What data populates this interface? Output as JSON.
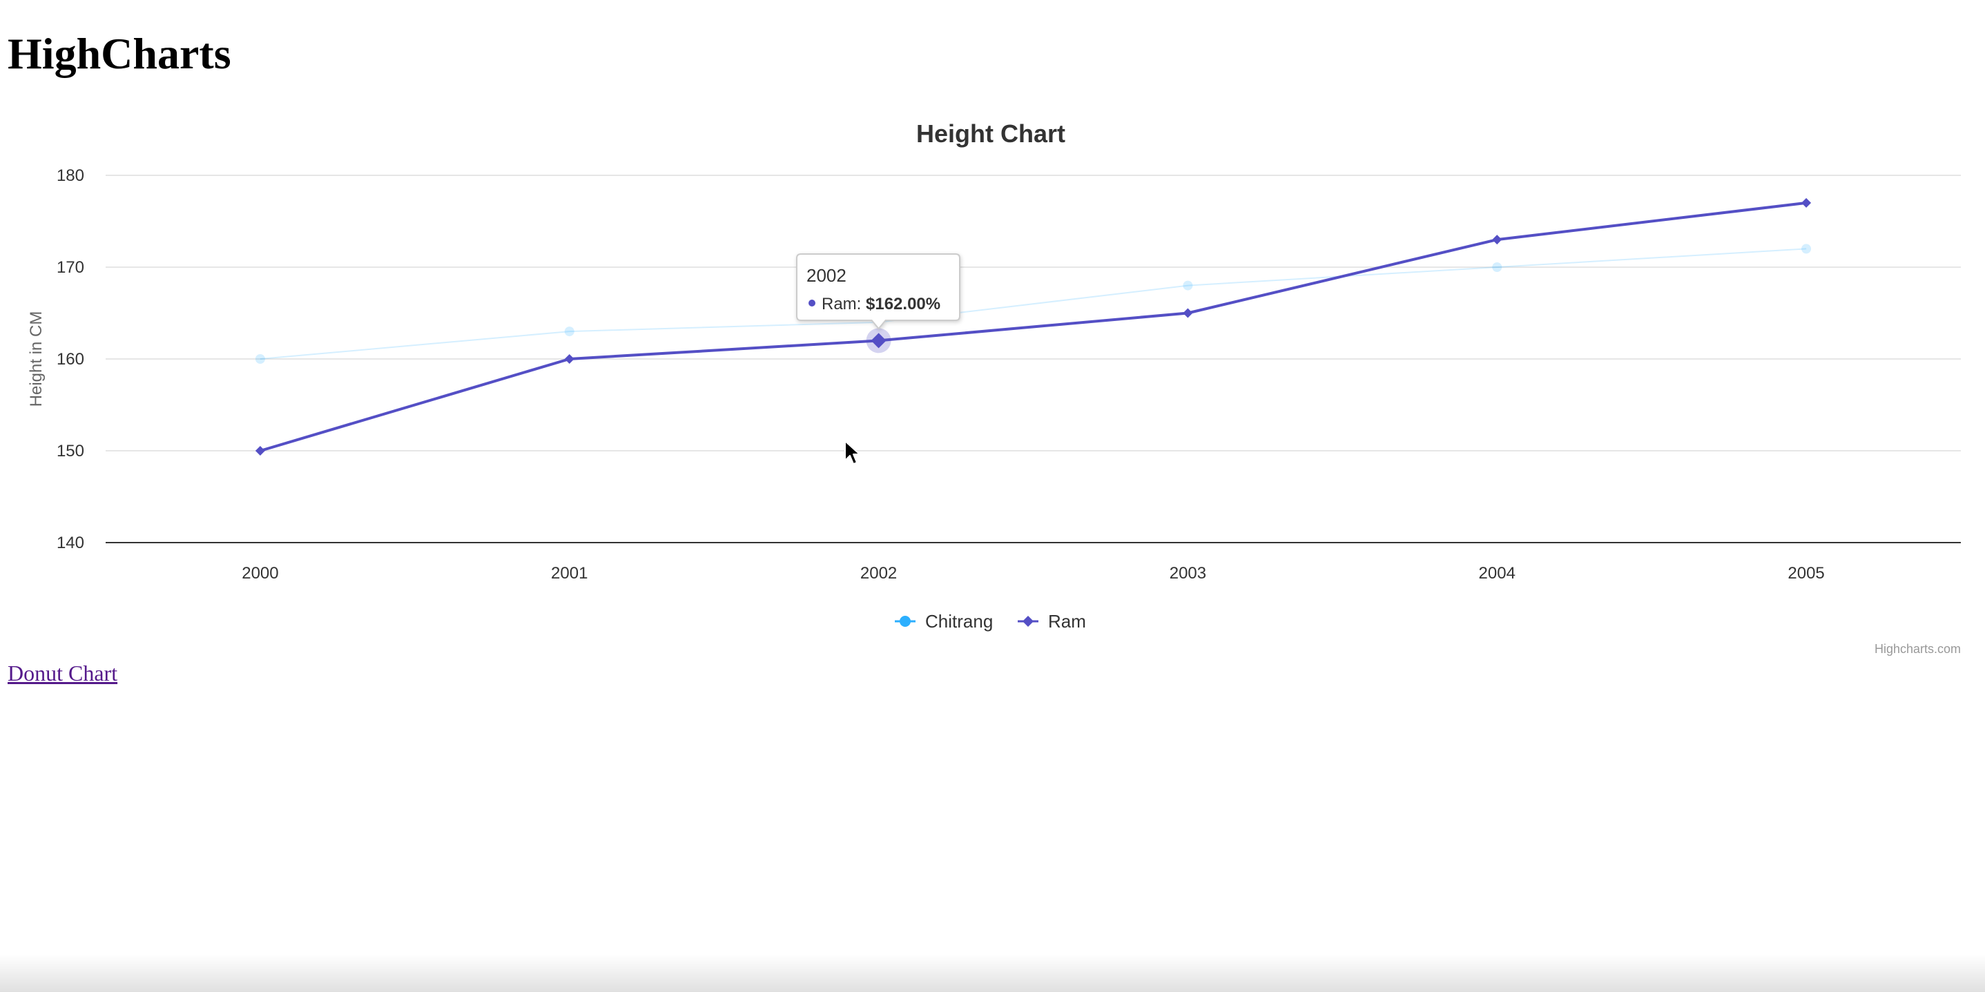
{
  "page": {
    "heading": "HighCharts",
    "link_label": "Donut Chart"
  },
  "chart_data": {
    "type": "line",
    "title": "Height Chart",
    "xlabel": "",
    "ylabel": "Height in CM",
    "categories": [
      "2000",
      "2001",
      "2002",
      "2003",
      "2004",
      "2005"
    ],
    "ylim": [
      140,
      180
    ],
    "yticks": [
      140,
      150,
      160,
      170,
      180
    ],
    "grid": true,
    "legend": "bottom-center",
    "series": [
      {
        "name": "Chitrang",
        "values": [
          160,
          163,
          164,
          168,
          170,
          172
        ],
        "color": "#2caffe",
        "marker": "circle",
        "faded": true
      },
      {
        "name": "Ram",
        "values": [
          150,
          160,
          162,
          165,
          173,
          177
        ],
        "color": "#544fc5",
        "marker": "diamond",
        "faded": false
      }
    ],
    "tooltip": {
      "header": "2002",
      "series_label": "Ram: ",
      "value_text": "$162.00%",
      "series_index": 1,
      "point_index": 2
    },
    "credits": "Highcharts.com"
  }
}
